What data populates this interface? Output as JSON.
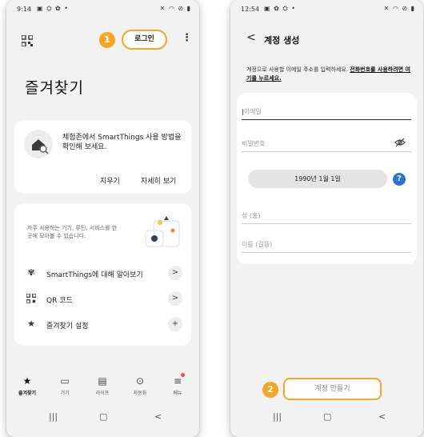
{
  "colors": {
    "accent_orange": "#f5a623",
    "help_blue": "#2a72d4",
    "notification_red": "#ff4d2e"
  },
  "screen1": {
    "status": {
      "time": "9:14",
      "left_icons": "▣ ⛭ ✿ •",
      "right_icons": "✕ ◠ ⊘ ▮"
    },
    "step_number": "1",
    "login_label": "로그인",
    "favorites_title": "즐겨찾기",
    "tip_card": {
      "text": "체험존에서 SmartThings 사용 방법을 확인해 보세요.",
      "dismiss_label": "지우기",
      "more_label": "자세히 보기"
    },
    "menu_card": {
      "description": "자주 사용하는 기기, 루틴, 서비스를 한 곳에 모아볼 수 있습니다.",
      "items": [
        {
          "icon": "smartthings-icon",
          "label": "SmartThings에 대해 알아보기",
          "action": ">"
        },
        {
          "icon": "qr-code-icon",
          "label": "QR 코드",
          "action": ">"
        },
        {
          "icon": "star-icon",
          "label": "즐겨찾기 설정",
          "action": "+"
        }
      ]
    },
    "bottom_nav": [
      {
        "icon": "star-icon",
        "label": "즐겨찾기"
      },
      {
        "icon": "devices-icon",
        "label": "기기"
      },
      {
        "icon": "life-icon",
        "label": "라이프"
      },
      {
        "icon": "automation-icon",
        "label": "자동화"
      },
      {
        "icon": "menu-icon",
        "label": "메뉴"
      }
    ]
  },
  "screen2": {
    "status": {
      "time": "12:54",
      "left_icons": "▣ ✿ ⛭ •",
      "right_icons": "✕ ◠ ⊘ ▮"
    },
    "title": "계정 생성",
    "instruction": "계정으로 사용할 이메일 주소를 입력하세요.",
    "instruction_link": "전화번호를 사용하려면 여기를 누르세요.",
    "email_placeholder": "이메일",
    "password_placeholder": "비밀번호",
    "dob_value": "1990년 1월 1일",
    "help_label": "?",
    "last_name_placeholder": "성 (홍)",
    "first_name_placeholder": "이름 (길동)",
    "step_number": "2",
    "create_label": "계정 만들기"
  }
}
